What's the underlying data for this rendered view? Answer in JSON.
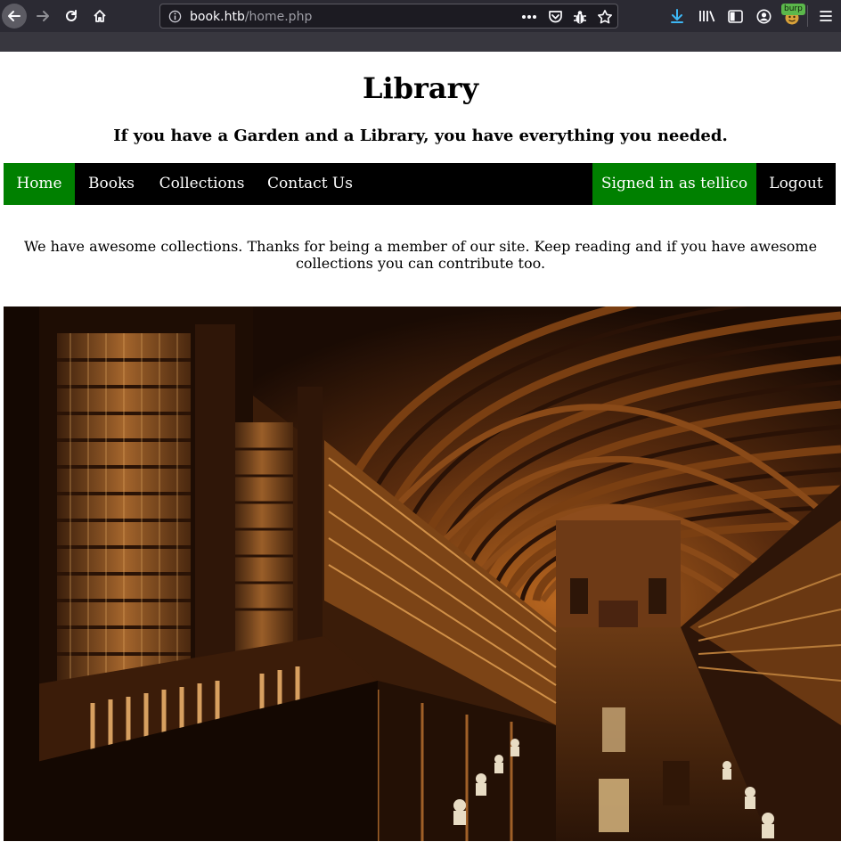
{
  "browser": {
    "url_host": "book.htb",
    "url_path": "/home.php",
    "extension_badge": "burp"
  },
  "page": {
    "title": "Library",
    "tagline": "If you have a Garden and a Library, you have everything you needed."
  },
  "navbar": {
    "home": "Home",
    "books": "Books",
    "collections": "Collections",
    "contact": "Contact Us",
    "signed_in": "Signed in as tellico",
    "logout": "Logout"
  },
  "welcome": {
    "text": "We have awesome collections. Thanks for being a member of our site. Keep reading and if you have awesome collections you can contribute too."
  },
  "colors": {
    "nav_background": "#000000",
    "nav_active": "#008000",
    "chrome_background": "#2b2a33"
  }
}
